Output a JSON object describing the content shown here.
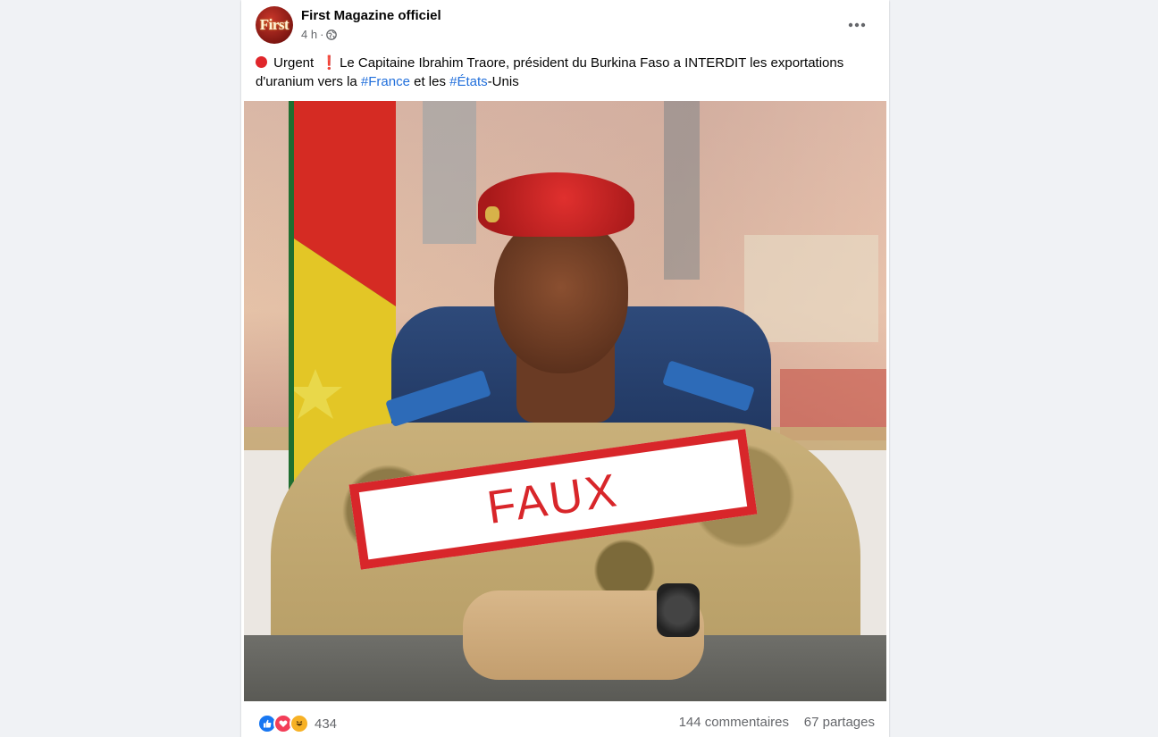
{
  "post": {
    "page_name": "First Magazine officiel",
    "avatar_text": "First",
    "time": "4 h",
    "time_separator": "·",
    "caption": {
      "part1": "Urgent",
      "part2": "Le Capitaine Ibrahim Traore, président du Burkina Faso a INTERDIT les exportations d'uranium vers la",
      "hashtag1": "#France",
      "part3": "et les",
      "hashtag2": "#États",
      "part4": "-Unis"
    },
    "image": {
      "stamp_text": "FAUX"
    },
    "footer": {
      "reaction_count": "434",
      "comments": "144 commentaires",
      "shares": "67 partages"
    }
  },
  "icons": {
    "more": "more-horizontal-icon",
    "audience": "globe-icon",
    "reactions": [
      "like-icon",
      "love-icon",
      "haha-icon"
    ]
  },
  "colors": {
    "link": "#216fdb",
    "stamp": "#d8262a",
    "like": "#1877f2",
    "love": "#f33e58",
    "haha": "#f7b125"
  }
}
